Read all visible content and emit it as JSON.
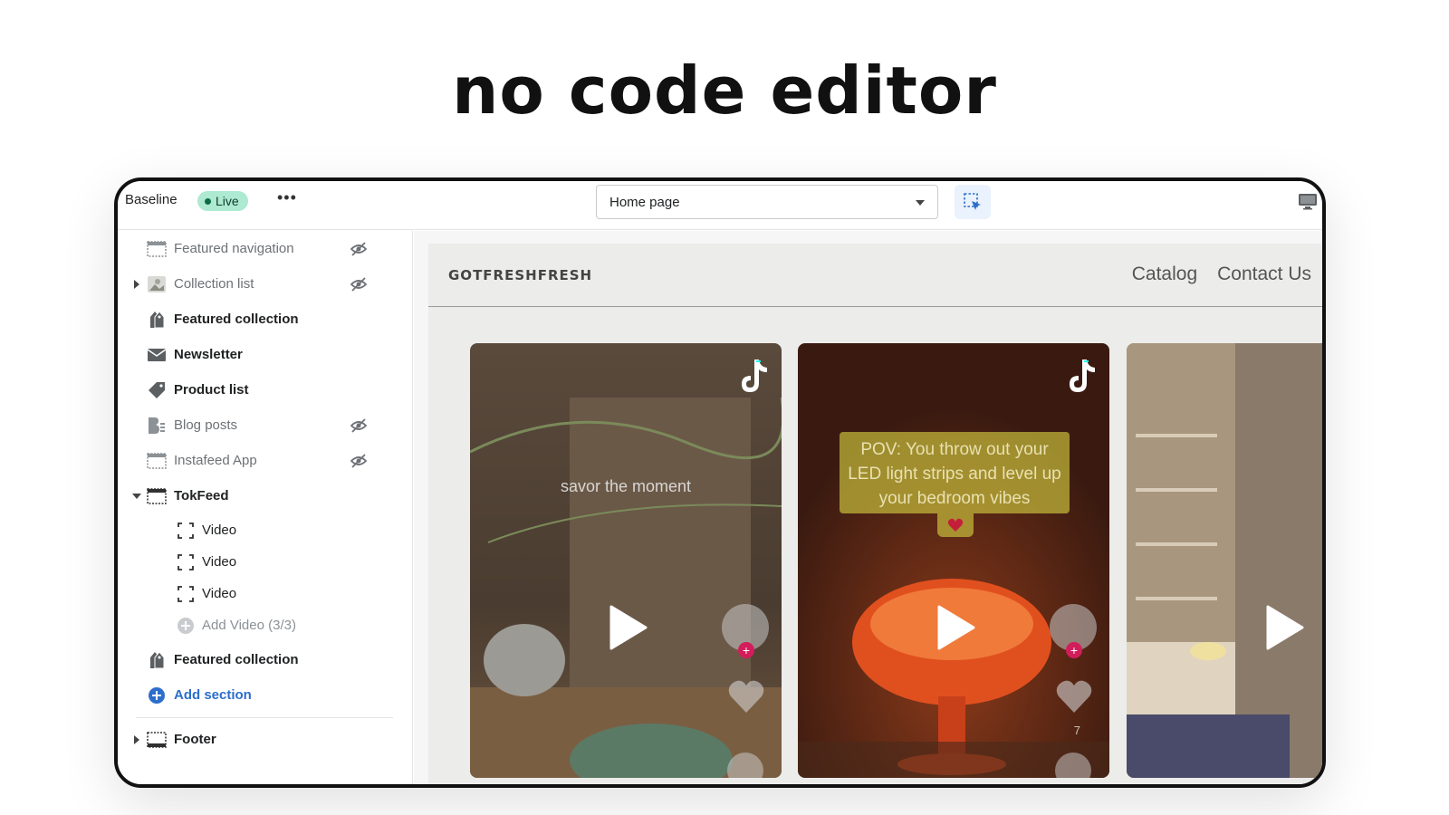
{
  "headline": "no code editor",
  "topbar": {
    "theme_name": "Baseline",
    "live_badge": "Live",
    "more_label": "•••",
    "page_select": "Home page"
  },
  "sidebar": {
    "sections": [
      {
        "label": "Featured navigation",
        "icon": "section-icon",
        "hidden": true
      },
      {
        "label": "Collection list",
        "icon": "image-icon",
        "hidden": true,
        "collapsible": true
      },
      {
        "label": "Featured collection",
        "icon": "collection-icon",
        "hidden": false
      },
      {
        "label": "Newsletter",
        "icon": "mail-icon",
        "hidden": false
      },
      {
        "label": "Product list",
        "icon": "tag-icon",
        "hidden": false
      },
      {
        "label": "Blog posts",
        "icon": "blog-icon",
        "hidden": true
      },
      {
        "label": "Instafeed App",
        "icon": "section-icon",
        "hidden": true
      },
      {
        "label": "TokFeed",
        "icon": "section-icon",
        "hidden": false,
        "expanded": true
      }
    ],
    "tokfeed_blocks": [
      "Video",
      "Video",
      "Video"
    ],
    "add_video": "Add Video (3/3)",
    "featured_collection_2": "Featured collection",
    "add_section": "Add section",
    "footer": "Footer"
  },
  "store": {
    "logo": "GOTFRESHFRESH",
    "nav": [
      "Catalog",
      "Contact Us"
    ],
    "videos": [
      {
        "caption": "savor the moment"
      },
      {
        "caption": "POV: You throw out your LED light strips and level up your bedroom vibes",
        "likes": "7"
      },
      {
        "caption": ""
      }
    ]
  },
  "colors": {
    "accent": "#2c6ecb",
    "live_badge_bg": "#aee9d1",
    "tiktok_red": "#d21d5b"
  }
}
